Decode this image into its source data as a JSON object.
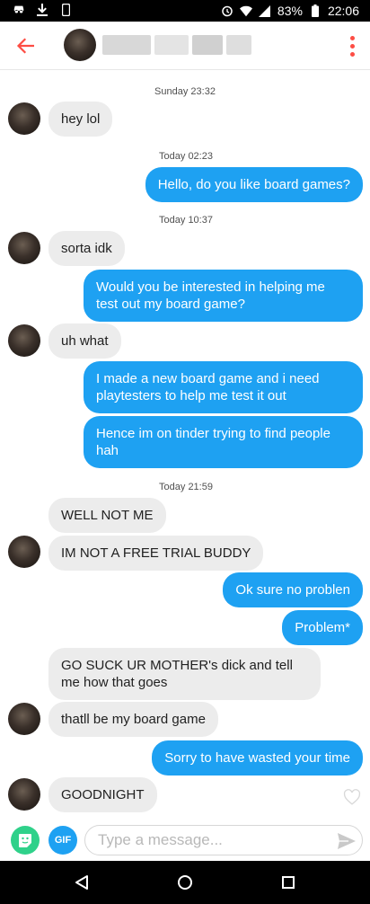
{
  "status_bar": {
    "battery": "83%",
    "time": "22:06"
  },
  "header": {
    "name_blur_colors": [
      "#d5d5d5",
      "#e2e2e2",
      "#cfcfcf",
      "#dddddd"
    ],
    "accent": "#fd4d44"
  },
  "chat": {
    "timestamps": {
      "t1": "Sunday 23:32",
      "t2": "Today 02:23",
      "t3": "Today 10:37",
      "t4": "Today 21:59"
    },
    "messages": {
      "m1": "hey lol",
      "m2": "Hello, do you like board games?",
      "m3": "sorta idk",
      "m4": "Would you be interested in helping me test out my board game?",
      "m5": "uh what",
      "m6": "I made a new board game and i need playtesters to help me test it out",
      "m7": "Hence im on tinder trying to find people hah",
      "m8": "WELL NOT ME",
      "m9": "IM NOT A FREE TRIAL BUDDY",
      "m10": "Ok sure no problen",
      "m11": "Problem*",
      "m12": "GO SUCK UR MOTHER's dick and tell me how that goes",
      "m13": "thatll be my board game",
      "m14": "Sorry to have wasted your time",
      "m15": "GOODNIGHT"
    },
    "colors": {
      "outgoing": "#1ea1f2",
      "incoming": "#ececec"
    }
  },
  "composer": {
    "gif_label": "GIF",
    "placeholder": "Type a message..."
  }
}
